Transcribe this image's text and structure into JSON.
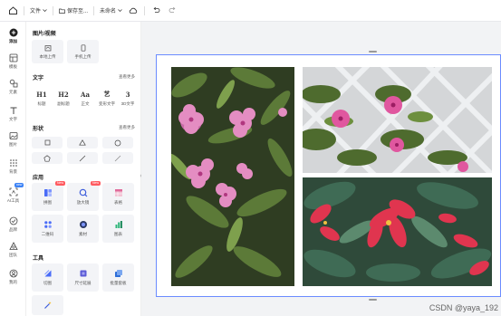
{
  "topbar": {
    "file_label": "文件",
    "save_label": "保存至...",
    "doc_title": "未命名"
  },
  "rail": [
    {
      "label": "添加",
      "icon": "add-icon",
      "active": true
    },
    {
      "label": "模板",
      "icon": "template-icon"
    },
    {
      "label": "元素",
      "icon": "element-icon"
    },
    {
      "label": "文字",
      "icon": "text-icon"
    },
    {
      "label": "图片",
      "icon": "image-icon"
    },
    {
      "label": "背景",
      "icon": "background-icon"
    },
    {
      "label": "AI工具",
      "icon": "ai-tool-icon",
      "badge": "new"
    },
    {
      "label": "品牌",
      "icon": "brand-icon"
    },
    {
      "label": "团队",
      "icon": "team-icon"
    },
    {
      "label": "我的",
      "icon": "my-icon"
    }
  ],
  "panel": {
    "media": {
      "title": "图片/视频",
      "items": [
        {
          "label": "本地上传",
          "icon": "local-upload-icon"
        },
        {
          "label": "手机上传",
          "icon": "phone-upload-icon"
        }
      ]
    },
    "text": {
      "title": "文字",
      "more": "查看更多",
      "items": [
        {
          "glyph": "H1",
          "label": "标题"
        },
        {
          "glyph": "H2",
          "label": "副标题"
        },
        {
          "glyph": "Aa",
          "label": "正文"
        },
        {
          "glyph": "艺",
          "label": "变形文字"
        },
        {
          "glyph": "3",
          "label": "3D文字"
        }
      ]
    },
    "shapes": {
      "title": "形状",
      "more": "查看更多",
      "items": [
        "square-shape-icon",
        "triangle-shape-icon",
        "circle-shape-icon",
        "pentagon-shape-icon",
        "line-shape-icon",
        "diagonal-line-shape-icon"
      ]
    },
    "apps": {
      "title": "应用",
      "items": [
        {
          "label": "拼图",
          "icon": "collage-icon",
          "badge": "New"
        },
        {
          "label": "放大镜",
          "icon": "magnifier-icon",
          "badge": "New"
        },
        {
          "label": "表格",
          "icon": "table-icon"
        },
        {
          "label": "二维码",
          "icon": "qrcode-icon"
        },
        {
          "label": "素材",
          "icon": "material-icon"
        },
        {
          "label": "图表",
          "icon": "chart-icon"
        }
      ]
    },
    "tools": {
      "title": "工具",
      "items": [
        {
          "label": "切图",
          "icon": "slice-icon"
        },
        {
          "label": "尺寸延展",
          "icon": "resize-icon"
        },
        {
          "label": "批量套板",
          "icon": "batch-icon"
        },
        {
          "label": "",
          "icon": "magic-wand-icon"
        }
      ]
    }
  },
  "colors": {
    "accent": "#6b8cff",
    "selection": "#4a7dff",
    "new_badge": "#ff5a5f"
  },
  "watermark": "CSDN @yaya_192"
}
